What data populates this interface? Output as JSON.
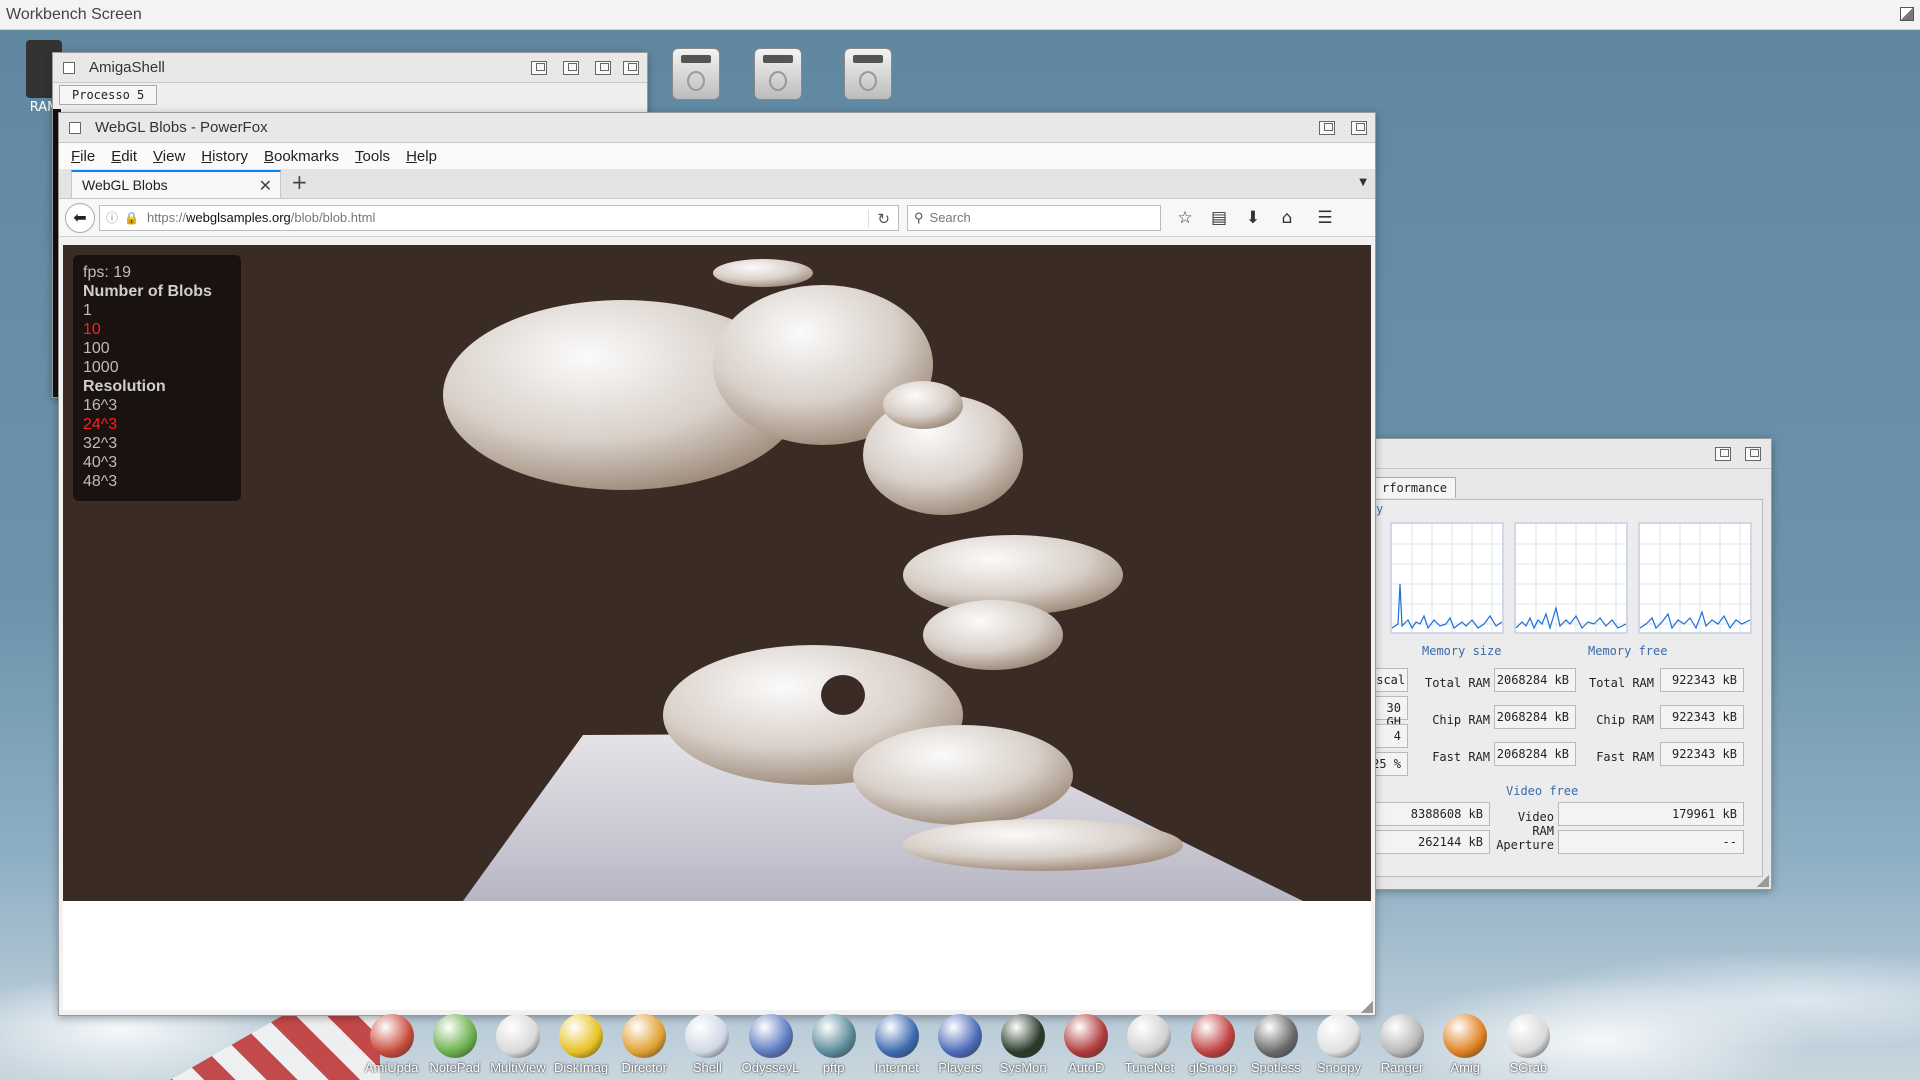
{
  "workbench": {
    "title": "Workbench Screen"
  },
  "desktop": {
    "ram_label": "RAM"
  },
  "shell": {
    "title": "AmigaShell",
    "process_tab": "Processo 5"
  },
  "browser": {
    "title": "WebGL Blobs - PowerFox",
    "menu": [
      "File",
      "Edit",
      "View",
      "History",
      "Bookmarks",
      "Tools",
      "Help"
    ],
    "tab_label": "WebGL Blobs",
    "url_scheme": "https://",
    "url_host": "webglsamples.org",
    "url_path": "/blob/blob.html",
    "search_placeholder": "Search",
    "overlay": {
      "fps": "fps: 19",
      "blobs_heading": "Number of Blobs",
      "blob_options": [
        "1",
        "10",
        "100",
        "1000"
      ],
      "blob_selected": "10",
      "resolution_heading": "Resolution",
      "resolution_options": [
        "16^3",
        "24^3",
        "32^3",
        "40^3",
        "48^3"
      ],
      "resolution_selected": "24^3"
    },
    "colors": {
      "selected": "#ff2020",
      "canvas_bg": "#3a2b24"
    }
  },
  "performance": {
    "tab_label": "rformance",
    "clipped_section_label": "y",
    "memory_size_title": "Memory size",
    "memory_free_title": "Memory free",
    "video_free_title": "Video free",
    "left_values": [
      "escal",
      "30 GH",
      "4",
      "25 %",
      "8388608 kB",
      "262144 kB"
    ],
    "memory_size": [
      {
        "label": "Total RAM",
        "value": "2068284 kB"
      },
      {
        "label": "Chip RAM",
        "value": "2068284 kB"
      },
      {
        "label": "Fast RAM",
        "value": "2068284 kB"
      }
    ],
    "memory_free": [
      {
        "label": "Total RAM",
        "value": "922343 kB"
      },
      {
        "label": "Chip RAM",
        "value": "922343 kB"
      },
      {
        "label": "Fast RAM",
        "value": "922343 kB"
      }
    ],
    "video_free": [
      {
        "label": "Video RAM",
        "value": "179961 kB"
      },
      {
        "label": "Aperture",
        "value": "--"
      }
    ]
  },
  "dock": [
    {
      "label": "AmiUpda",
      "color": "#c84a3a"
    },
    {
      "label": "NotePad",
      "color": "#6ab04c"
    },
    {
      "label": "MultiView",
      "color": "#d9d9d9"
    },
    {
      "label": "DiskImag",
      "color": "#e8c020"
    },
    {
      "label": "Director",
      "color": "#e0a030"
    },
    {
      "label": "Shell",
      "color": "#cfd8e6"
    },
    {
      "label": "OdysseyL",
      "color": "#5a7ac0"
    },
    {
      "label": "pftp",
      "color": "#5a8a9a"
    },
    {
      "label": "Internet",
      "color": "#3a6ab0"
    },
    {
      "label": "Players",
      "color": "#4a6ab8"
    },
    {
      "label": "SysMon",
      "color": "#2a3a2a"
    },
    {
      "label": "AutoD",
      "color": "#b03a3a"
    },
    {
      "label": "TuneNet",
      "color": "#d0d0d0"
    },
    {
      "label": "glSnoop",
      "color": "#c04040"
    },
    {
      "label": "Spotless",
      "color": "#6a6a6a"
    },
    {
      "label": "Snoopy",
      "color": "#e0e0e0"
    },
    {
      "label": "Ranger",
      "color": "#b8b8b8"
    },
    {
      "label": "Amig",
      "color": "#e08020"
    },
    {
      "label": "SGrab",
      "color": "#d8d8d8"
    }
  ]
}
